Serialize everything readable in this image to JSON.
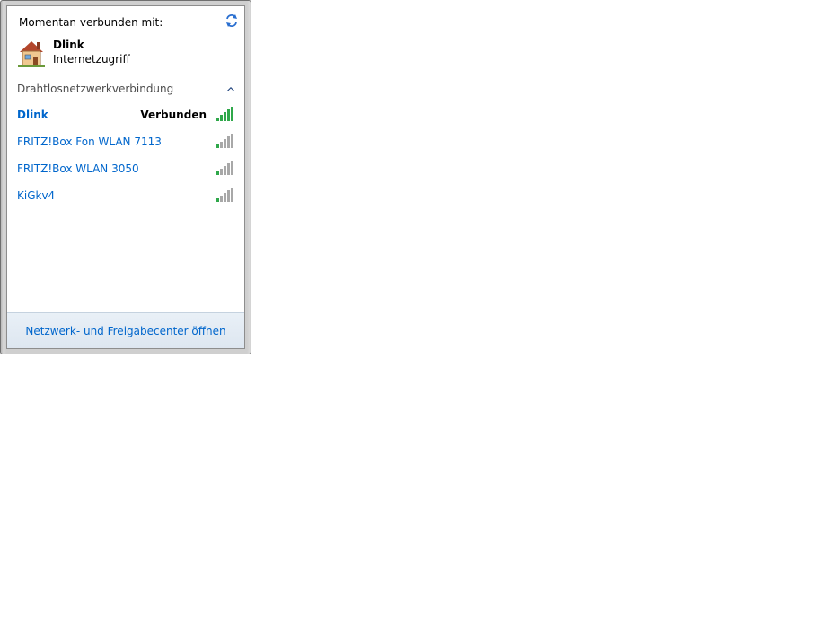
{
  "header": {
    "label": "Momentan verbunden mit:"
  },
  "current_connection": {
    "name": "Dlink",
    "status": "Internetzugriff"
  },
  "section": {
    "label": "Drahtlosnetzwerkverbindung"
  },
  "networks": [
    {
      "name": "Dlink",
      "state": "Verbunden",
      "bold": true,
      "signal_icon": "signal-strong-green-icon"
    },
    {
      "name": "FRITZ!Box Fon WLAN 7113",
      "state": "",
      "bold": false,
      "signal_icon": "signal-weak-icon"
    },
    {
      "name": "FRITZ!Box WLAN 3050",
      "state": "",
      "bold": false,
      "signal_icon": "signal-weak-icon"
    },
    {
      "name": "KiGkv4",
      "state": "",
      "bold": false,
      "signal_icon": "signal-weak-icon"
    }
  ],
  "footer": {
    "link": "Netzwerk- und Freigabecenter öffnen"
  },
  "colors": {
    "link": "#0066cc",
    "signal_green": "#2fa84a",
    "signal_gray": "#a8a8a8"
  }
}
